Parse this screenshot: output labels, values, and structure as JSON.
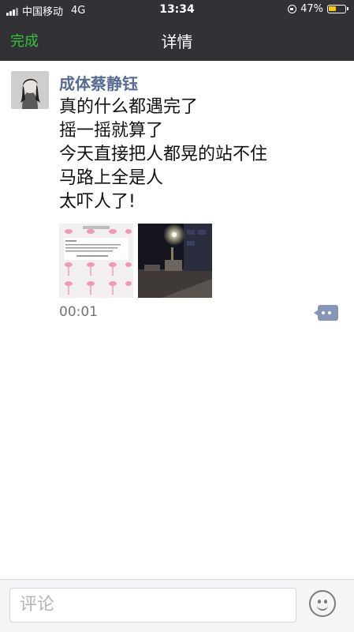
{
  "status_bar": {
    "carrier": "中国移动",
    "network": "4G",
    "time": "13:34",
    "battery": "47%",
    "battery_level": 0.47
  },
  "nav": {
    "done_label": "完成",
    "title": "详情"
  },
  "post": {
    "author": "成体蔡静钰",
    "lines": [
      "真的什么都遇完了",
      "摇一摇就算了",
      "今天直接把人都晃的站不住",
      "马路上全是人",
      "太吓人了!"
    ],
    "time": "00:01",
    "images": [
      "flamingo-screenshot-image",
      "night-street-photo"
    ]
  },
  "comment": {
    "placeholder": "评论"
  },
  "colors": {
    "bar_bg": "#323236",
    "accent_green": "#35c238",
    "author_link": "#576b95",
    "battery_yellow": "#f6c90e"
  }
}
